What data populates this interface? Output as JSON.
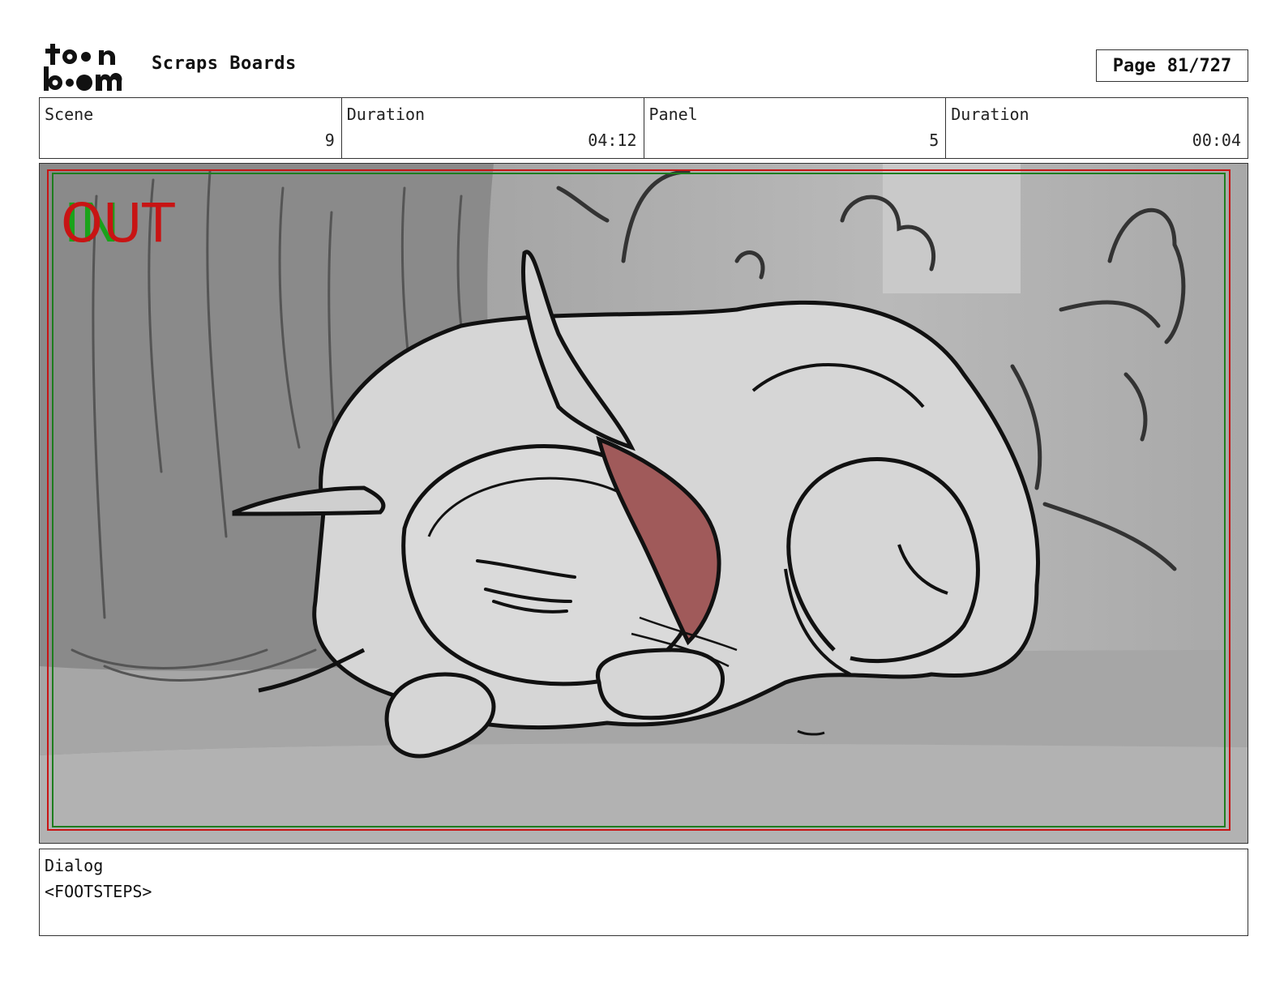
{
  "header": {
    "logo_text": "toon boom",
    "project_title": "Scraps Boards",
    "page_label": "Page",
    "page_number": "81/727"
  },
  "info": [
    {
      "label": "Scene",
      "value": "9"
    },
    {
      "label": "Duration",
      "value": "04:12"
    },
    {
      "label": "Panel",
      "value": "5"
    },
    {
      "label": "Duration",
      "value": "00:04"
    }
  ],
  "panel": {
    "overlay_in": "IN",
    "overlay_out": "OUT",
    "colors": {
      "in": "#1aa31a",
      "out": "#c81414",
      "ear_fill": "#a05a5a"
    }
  },
  "dialog": {
    "label": "Dialog",
    "text": "<FOOTSTEPS>"
  }
}
